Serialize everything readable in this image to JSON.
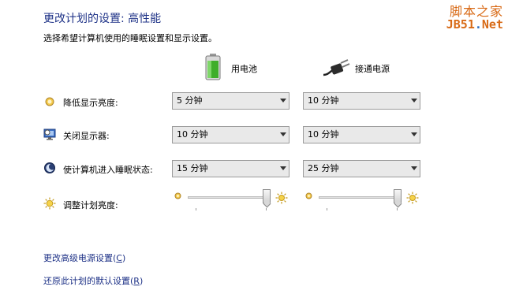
{
  "page": {
    "title": "更改计划的设置: 高性能",
    "subtitle": "选择希望计算机使用的睡眠设置和显示设置。"
  },
  "watermark": {
    "line1": "脚本之家",
    "line2_a": "JB51",
    "line2_dot": ".",
    "line2_b": "Net"
  },
  "columns": {
    "battery": {
      "label": "用电池",
      "icon": "battery-icon"
    },
    "plugged": {
      "label": "接通电源",
      "icon": "power-plug-icon"
    }
  },
  "rows": {
    "dim": {
      "label": "降低显示亮度:",
      "battery_value": "5 分钟",
      "plugged_value": "10 分钟",
      "icon": "dim-display-icon"
    },
    "off": {
      "label": "关闭显示器:",
      "battery_value": "10 分钟",
      "plugged_value": "10 分钟",
      "icon": "monitor-icon"
    },
    "sleep": {
      "label": "使计算机进入睡眠状态:",
      "battery_value": "15 分钟",
      "plugged_value": "25 分钟",
      "icon": "sleep-icon"
    },
    "brightness": {
      "label": "调整计划亮度:",
      "battery_level": 1.0,
      "plugged_level": 1.0,
      "icon": "brightness-icon"
    }
  },
  "links": {
    "advanced_text": "更改高级电源设置(",
    "advanced_key": "C",
    "advanced_end": ")",
    "restore_text": "还原此计划的默认设置(",
    "restore_key": "R",
    "restore_end": ")"
  },
  "colors": {
    "title": "#1e3287",
    "link": "#1e3287",
    "watermark": "#d86a16"
  }
}
